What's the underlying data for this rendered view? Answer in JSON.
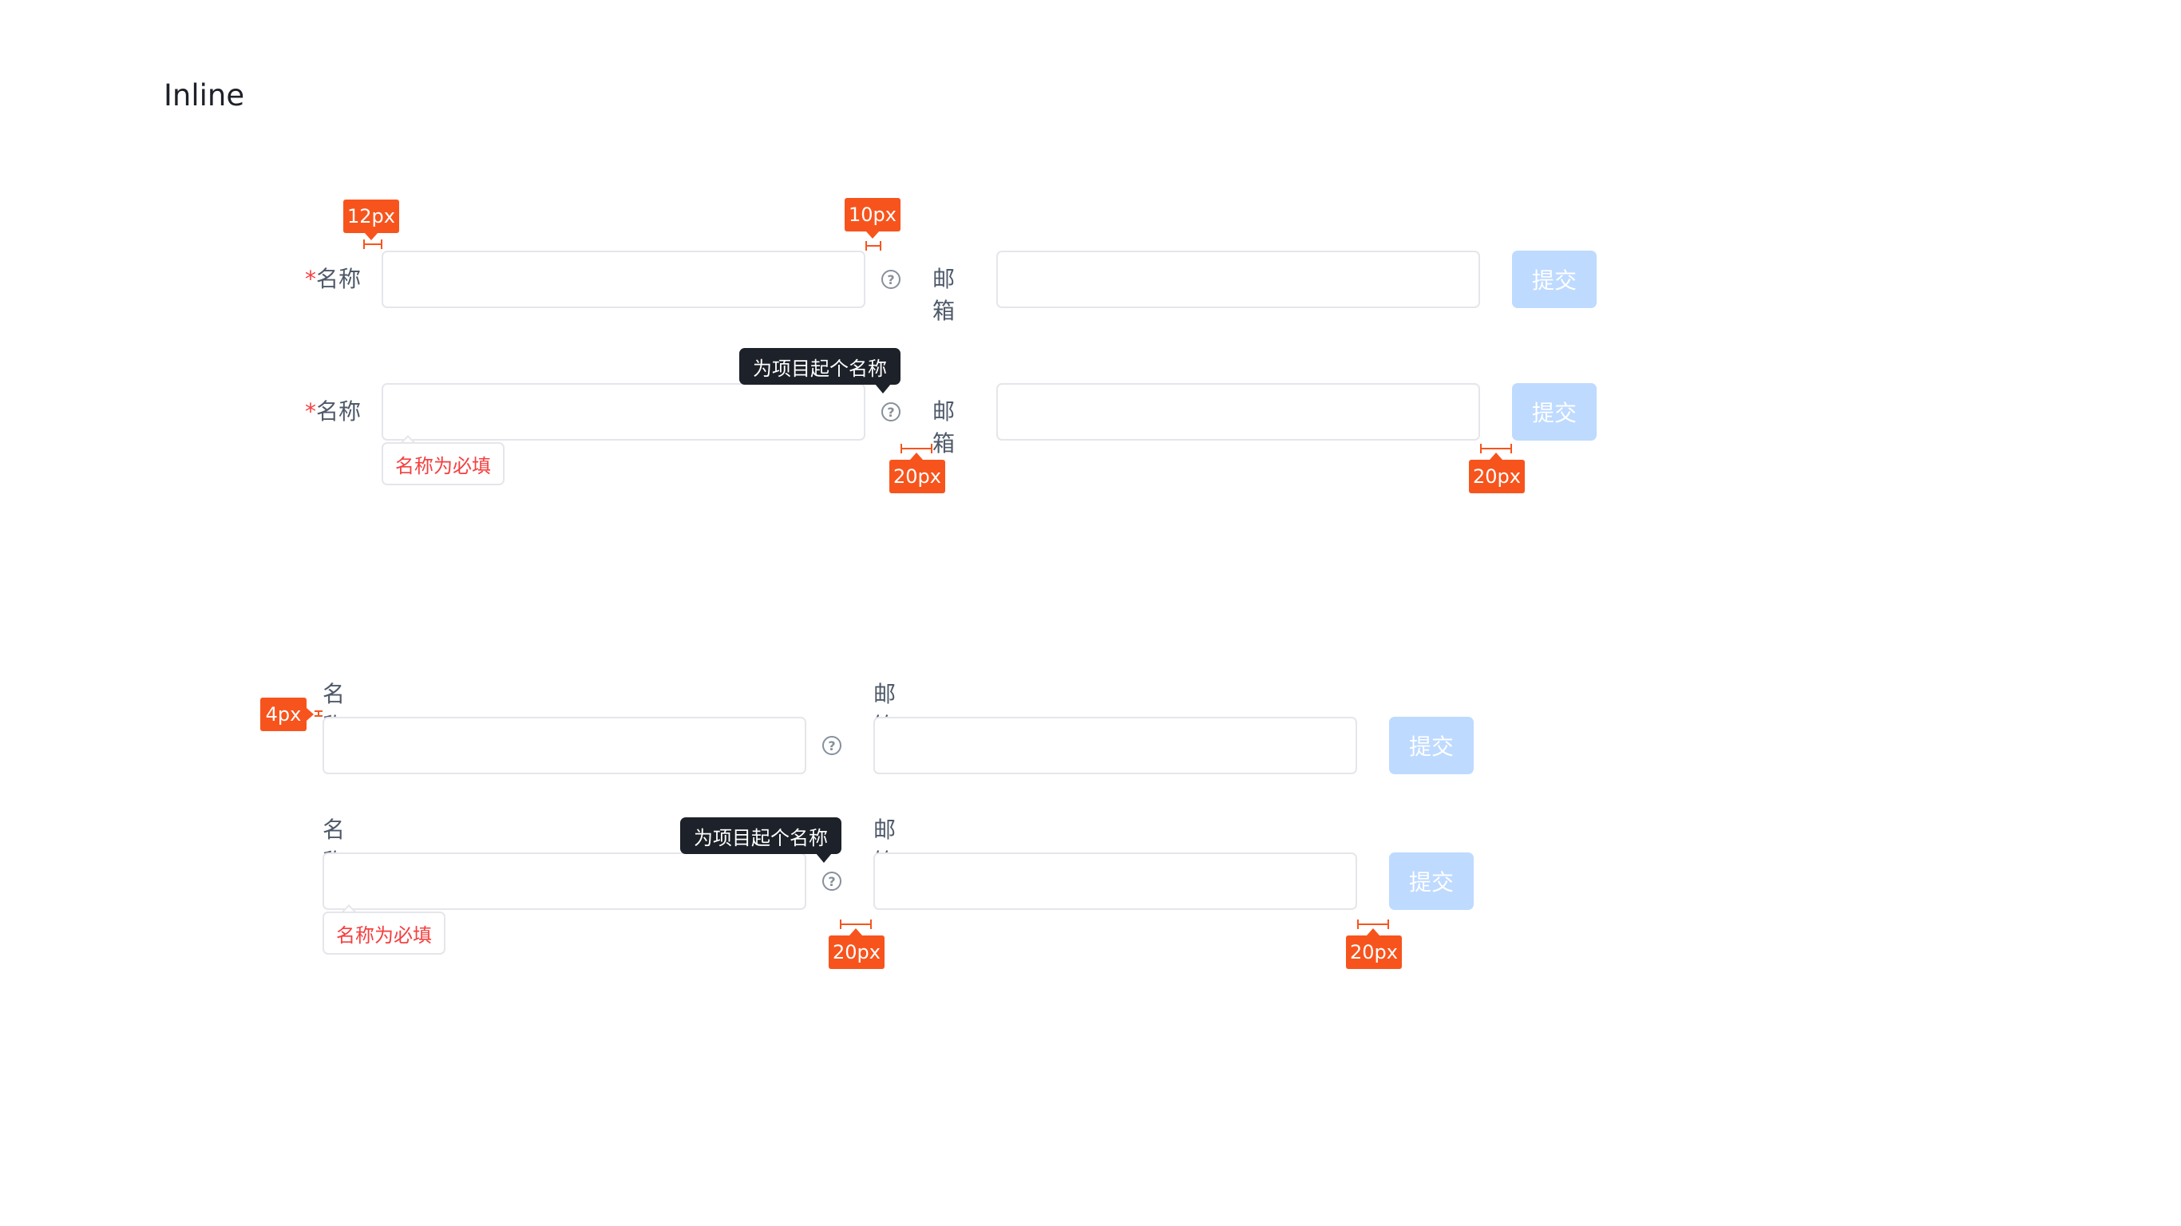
{
  "page": {
    "title": "Inline"
  },
  "form": {
    "required_mark": "*",
    "name_label": "名称",
    "email_label": "邮箱",
    "submit_label": "提交",
    "help_glyph": "?",
    "tooltip_text": "为项目起个名称",
    "error_text": "名称为必填"
  },
  "annotations": {
    "label_gap": "12px",
    "help_gap": "10px",
    "item_gap": "20px",
    "vertical_label_gap": "4px"
  },
  "colors": {
    "accent_disabled": "#bedaff",
    "error": "#f53f3f",
    "annotation": "#f7541d",
    "tooltip_bg": "#1d2129"
  }
}
